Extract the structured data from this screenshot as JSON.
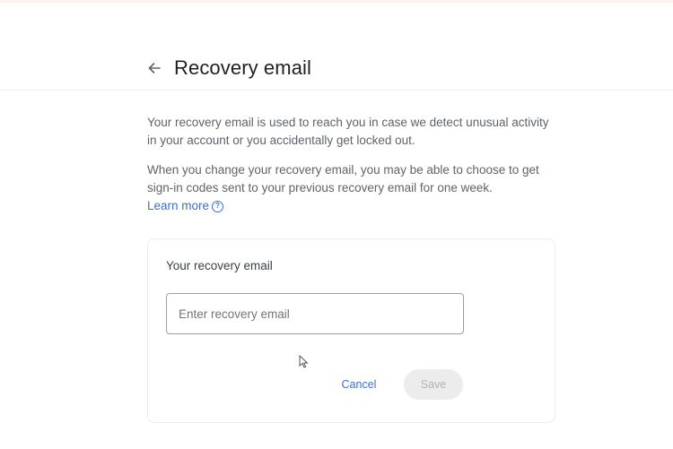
{
  "header": {
    "title": "Recovery email",
    "back_icon": "arrow-left-icon"
  },
  "description": {
    "paragraph1": "Your recovery email is used to reach you in case we detect unusual activity in your account or you accidentally get locked out.",
    "paragraph2": "When you change your recovery email, you may be able to choose to get sign-in codes sent to your previous recovery email for one week.",
    "learn_more": "Learn more",
    "help_icon_glyph": "?"
  },
  "card": {
    "label": "Your recovery email",
    "input": {
      "value": "",
      "placeholder": "Enter recovery email"
    },
    "cancel_label": "Cancel",
    "save_label": "Save"
  },
  "colors": {
    "link": "#3c6fc8",
    "disabled_button_bg": "#ececec",
    "disabled_button_text": "#b3b3b3"
  }
}
